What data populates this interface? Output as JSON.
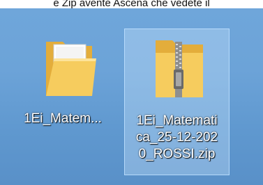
{
  "caption": "e Zip avente Ascena che vedete il",
  "desktop": {
    "items": [
      {
        "name": "1Ei_Matem...",
        "type": "folder",
        "icon": "folder-icon",
        "selected": false
      },
      {
        "name_lines": [
          "1Ei_Matemati",
          "ca_25-12-202",
          "0_ROSSI.zip"
        ],
        "type": "zip",
        "icon": "zip-folder-icon",
        "selected": true
      }
    ]
  },
  "colors": {
    "desktop": "#6ca3d8",
    "folder": "#f3c454",
    "selection": "#cde8ff"
  }
}
